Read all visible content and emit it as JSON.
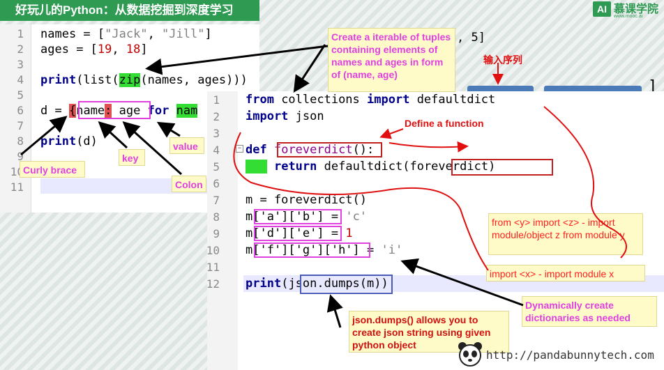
{
  "header": {
    "title": "好玩儿的Python：从数据挖掘到深度学习",
    "brand_ai": "AI",
    "brand_name": "慕课学院",
    "brand_url": "www.mooc.ai"
  },
  "editor1": {
    "line_numbers": [
      "1",
      "2",
      "3",
      "4",
      "5",
      "6",
      "7",
      "8",
      "9",
      "10",
      "11"
    ],
    "l1": {
      "a": "names",
      "b": " = [",
      "c": "\"Jack\"",
      "d": ", ",
      "e": "\"Jill\"",
      "f": "]"
    },
    "l2": {
      "a": "ages",
      "b": " = [",
      "c": "19",
      "d": ", ",
      "e": "18",
      "f": "]"
    },
    "l4": {
      "a": "print",
      "b": "(list(",
      "c": "zip",
      "d": "(names, ages)))"
    },
    "l6": {
      "a": "d",
      "b": " = ",
      "c": "{",
      "d": "name",
      "e": ":",
      "f": " age",
      "g": " ",
      "h": "for",
      "i": " ",
      "j": "nam"
    },
    "l8": {
      "a": "print",
      "b": "(d)"
    },
    "behind_text": ", 5]"
  },
  "editor2": {
    "line_numbers": [
      "1",
      "2",
      "3",
      "4",
      "5",
      "6",
      "7",
      "8",
      "9",
      "10",
      "11",
      "12"
    ],
    "l1": {
      "a": "from",
      "b": " collections ",
      "c": "import",
      "d": " ",
      "e": "defaultdict"
    },
    "l2": {
      "a": "import",
      "b": " ",
      "c": "json"
    },
    "l4": {
      "a": "def",
      "b": " ",
      "c": "foreverdict",
      "d": "():"
    },
    "l5": {
      "a": "return",
      "b": " defaultdict",
      "c": "(",
      "d": "foreverdict",
      "e": ")"
    },
    "l7": "m = foreverdict()",
    "l8": {
      "a": "m",
      "b": "['a']['b']",
      "c": " = ",
      "d": "'c'"
    },
    "l9": {
      "a": "m",
      "b": "['d']['e']",
      "c": " = ",
      "d": "1"
    },
    "l10": {
      "a": "m",
      "b": "['f']['g']['h']",
      "c": " = ",
      "d": "'i'"
    },
    "l12": {
      "a": "print",
      "b": "(",
      "c": "json.dumps",
      "d": "(m)",
      "e": ")"
    }
  },
  "annotations": {
    "zip_note": "Create a iterable of tuples containing elements of names and ages in form of (name, age)",
    "input_seq": "输入序列",
    "curly": "Curly brace",
    "key": "key",
    "value": "value",
    "colon": "Colon",
    "define_fn": "Define a function",
    "from_import": "from <y> import <z> - import module/object z from module y",
    "import_x": "import <x> - import module x",
    "dyn_dict": "Dynamically create dictionaries as needed",
    "json_dumps": "json.dumps() allows you to create json string using given python object"
  },
  "footer": {
    "url": "http://pandabunnytech.com"
  },
  "colors": {
    "brand_green": "#2e9a52",
    "annotation_magenta": "#e040e0",
    "annotation_red": "#d01010",
    "note_bg": "#fffbc8"
  }
}
